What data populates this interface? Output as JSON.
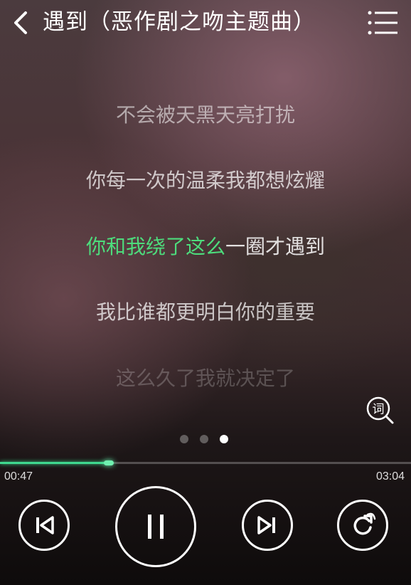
{
  "header": {
    "title": "遇到（恶作剧之吻主题曲）"
  },
  "lyrics": {
    "line_prev2": "不会被天黑天亮打扰",
    "line_prev1": "你每一次的温柔我都想炫耀",
    "current_sung": "你和我绕了这么",
    "current_unsung": "一圈才遇到",
    "line_next1": "我比谁都更明白你的重要",
    "line_next2": "这么久了我就决定了"
  },
  "lyric_button": {
    "glyph": "词"
  },
  "pager": {
    "count": 3,
    "active_index": 2
  },
  "progress": {
    "elapsed": "00:47",
    "total": "03:04",
    "fraction": 0.27
  },
  "colors": {
    "accent": "#4ddc7c",
    "progress": "#3fd98f"
  },
  "icons": {
    "back": "chevron-left-icon",
    "menu": "list-menu-icon",
    "lyric": "lyric-search-icon",
    "prev": "skip-previous-icon",
    "play_pause": "pause-icon",
    "next": "skip-next-icon",
    "extra": "share-rotate-icon"
  }
}
